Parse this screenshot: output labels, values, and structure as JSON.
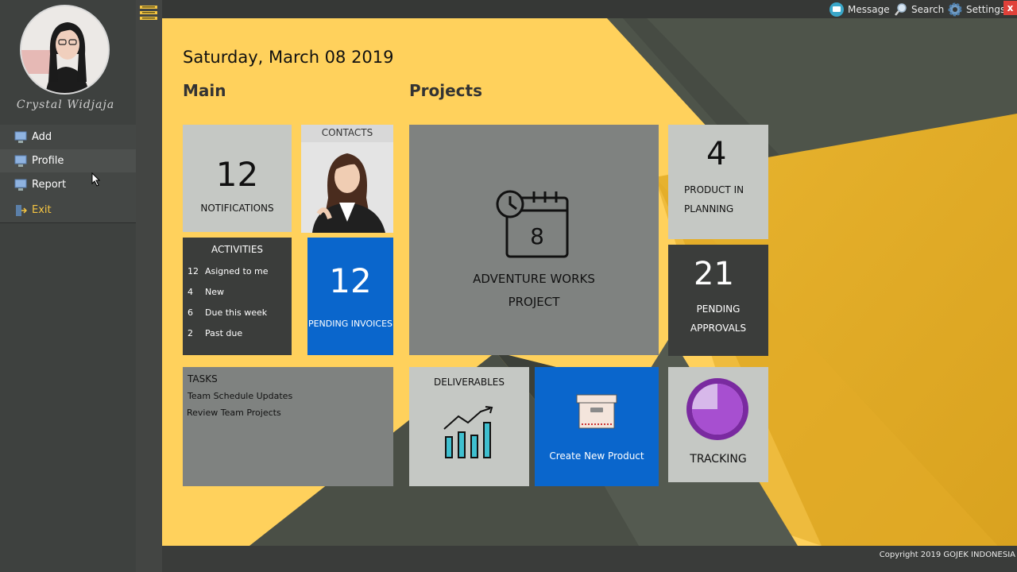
{
  "user": {
    "name": "Crystal Widjaja"
  },
  "menu": {
    "items": [
      {
        "label": "Add"
      },
      {
        "label": "Profile"
      },
      {
        "label": "Report"
      },
      {
        "label": "Exit"
      }
    ]
  },
  "topbar": {
    "message": "Message",
    "search": "Search",
    "settings": "Settings",
    "close": "x"
  },
  "date": "Saturday, March 08 2019",
  "sections": {
    "main": "Main",
    "projects": "Projects"
  },
  "tiles": {
    "notifications": {
      "count": "12",
      "label": "NOTIFICATIONS"
    },
    "contacts": {
      "label": "CONTACTS"
    },
    "activities": {
      "title": "ACTIVITIES",
      "rows": [
        {
          "count": "12",
          "label": "Asigned to me"
        },
        {
          "count": "4",
          "label": "New"
        },
        {
          "count": "6",
          "label": "Due this week"
        },
        {
          "count": "2",
          "label": "Past due"
        }
      ]
    },
    "invoices": {
      "count": "12",
      "label": "PENDING INVOICES"
    },
    "tasks": {
      "title": "TASKS",
      "items": [
        "Team Schedule Updates",
        "Review Team Projects"
      ]
    },
    "project": {
      "line1": "ADVENTURE WORKS",
      "line2": "PROJECT"
    },
    "planning": {
      "count": "4",
      "line1": "PRODUCT IN",
      "line2": "PLANNING"
    },
    "approvals": {
      "count": "21",
      "line1": "PENDING",
      "line2": "APPROVALS"
    },
    "deliverables": {
      "label": "DELIVERABLES"
    },
    "create": {
      "label": "Create New Product"
    },
    "tracking": {
      "label": "TRACKING",
      "progress": 0.75
    }
  },
  "footer": {
    "copyright": "Copyright 2019 GOJEK INDONESIA"
  },
  "colors": {
    "accent": "#ffd15c",
    "blue": "#0a66cc",
    "dark": "#3b3d3b",
    "light": "#c5c8c4",
    "grey": "#7f8280",
    "purple": "#8b3fb5"
  }
}
